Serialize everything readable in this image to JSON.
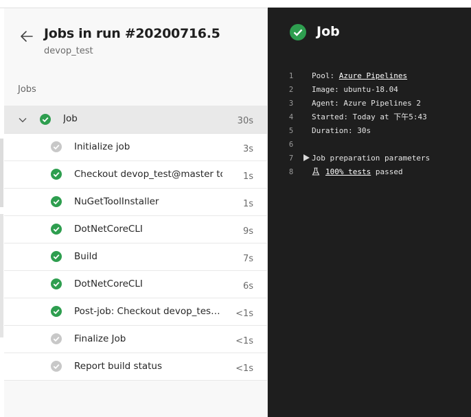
{
  "header": {
    "title": "Jobs in run #20200716.5",
    "subtitle": "devop_test"
  },
  "jobs_section_label": "Jobs",
  "job": {
    "label": "Job",
    "duration": "30s",
    "status": "succeeded"
  },
  "steps": [
    {
      "label": "Initialize job",
      "duration": "3s",
      "status": "skipped"
    },
    {
      "label": "Checkout devop_test@master to s",
      "duration": "1s",
      "status": "succeeded"
    },
    {
      "label": "NuGetToolInstaller",
      "duration": "1s",
      "status": "succeeded"
    },
    {
      "label": "DotNetCoreCLI",
      "duration": "9s",
      "status": "succeeded"
    },
    {
      "label": "Build",
      "duration": "7s",
      "status": "succeeded"
    },
    {
      "label": "DotNetCoreCLI",
      "duration": "6s",
      "status": "succeeded"
    },
    {
      "label": "Post-job: Checkout devop_test@...",
      "duration": "<1s",
      "status": "succeeded"
    },
    {
      "label": "Finalize Job",
      "duration": "<1s",
      "status": "skipped"
    },
    {
      "label": "Report build status",
      "duration": "<1s",
      "status": "skipped"
    }
  ],
  "detail": {
    "title": "Job",
    "log": {
      "line1": {
        "num": "1",
        "label": "Pool: ",
        "link": "Azure Pipelines"
      },
      "line2": {
        "num": "2",
        "text": "Image: ubuntu-18.04"
      },
      "line3": {
        "num": "3",
        "text": "Agent: Azure Pipelines 2"
      },
      "line4": {
        "num": "4",
        "text": "Started: Today at 下午5:43"
      },
      "line5": {
        "num": "5",
        "text": "Duration: 30s"
      },
      "line6": {
        "num": "6",
        "text": ""
      },
      "line7": {
        "num": "7",
        "text": "Job preparation parameters"
      },
      "line8": {
        "num": "8",
        "link": "100% tests",
        "text": " passed"
      }
    }
  },
  "colors": {
    "success": "#2e9e4f",
    "skipped": "#c8c8c8",
    "dark_panel": "#1e1e1e",
    "selected_row": "#e9e9e9"
  },
  "icons": {
    "back": "arrow-left-icon",
    "expand": "chevron-down-icon",
    "success": "check-circle-icon",
    "skipped": "skipped-circle-icon",
    "tests": "beaker-icon",
    "collapse_toggle": "triangle-right-icon"
  }
}
